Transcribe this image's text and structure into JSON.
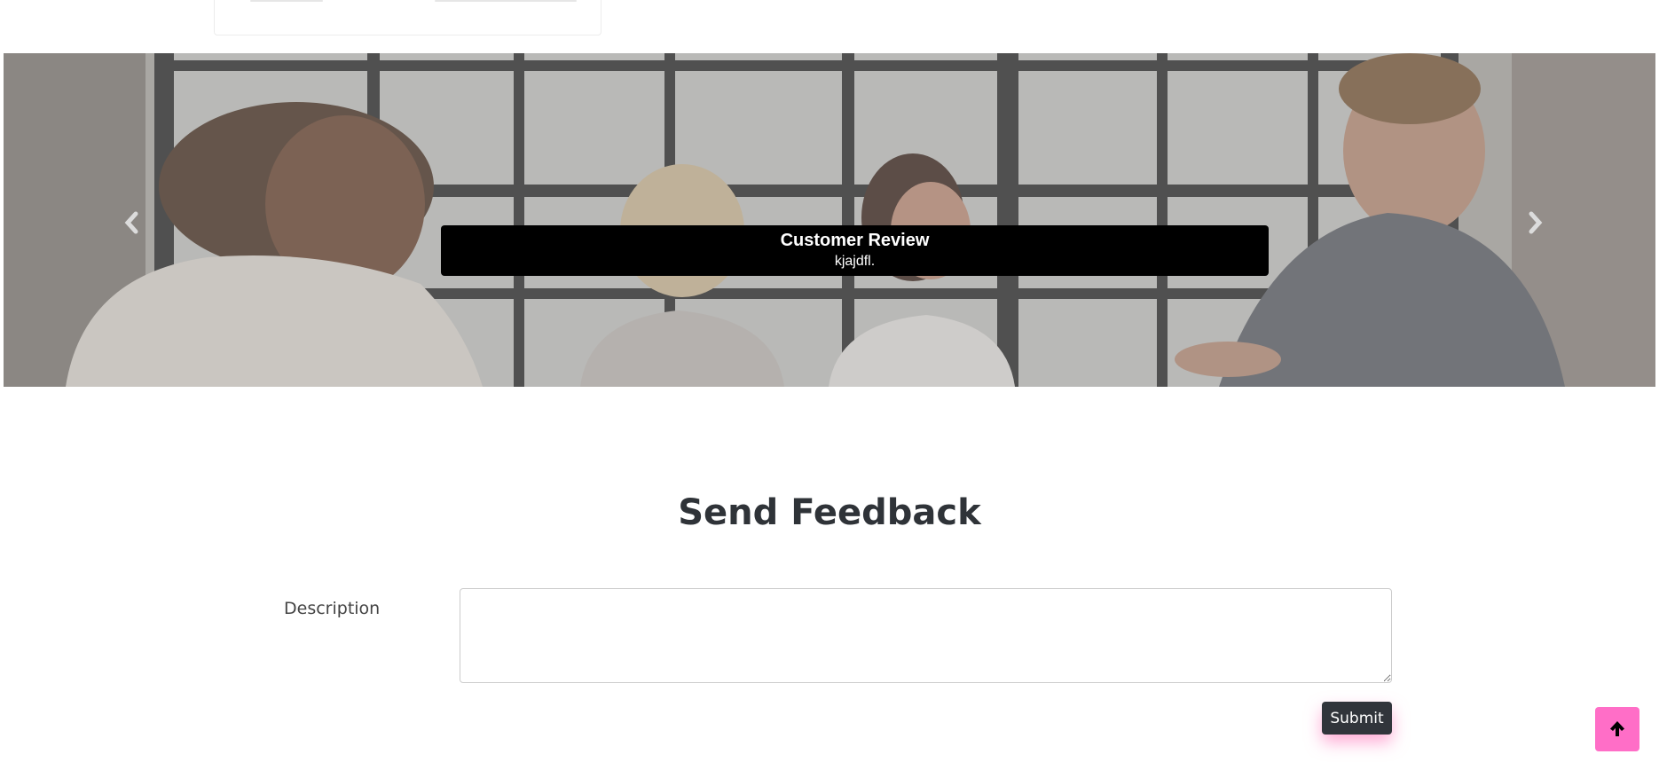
{
  "carousel": {
    "caption_title": "Customer Review",
    "caption_text": "kjajdfl."
  },
  "feedback": {
    "title": "Send Feedback",
    "description_label": "Description",
    "description_value": "",
    "submit_label": "Submit"
  },
  "icons": {
    "prev": "chevron-left-icon",
    "next": "chevron-right-icon",
    "back_to_top": "arrow-up-icon"
  },
  "colors": {
    "submit_bg": "#31353b",
    "back_to_top_bg": "#ff6ec7",
    "caption_bg": "#000000",
    "heading": "#2f3338"
  }
}
